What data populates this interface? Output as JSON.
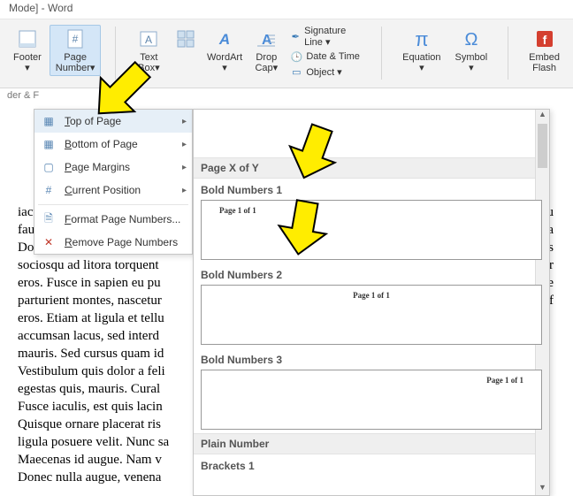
{
  "title": "Mode] - Word",
  "status": "der & F",
  "ribbon": {
    "footer": "Footer\n▾",
    "page_number": "Page\nNumber▾",
    "text_box": "Text\nBox▾",
    "quick_parts": "",
    "wordart": "WordArt\n▾",
    "drop_cap": "Drop\nCap▾",
    "signature": "Signature Line ▾",
    "datetime": "Date & Time",
    "object": "Object ▾",
    "equation": "Equation\n▾",
    "symbol": "Symbol\n▾",
    "embed_flash": "Embed\nFlash"
  },
  "menu": {
    "top": "Top of Page",
    "bottom": "Bottom of Page",
    "margins": "Page Margins",
    "current": "Current Position",
    "format": "Format Page Numbers...",
    "remove": "Remove Page Numbers"
  },
  "gallery": {
    "section": "Page X of Y",
    "items": [
      {
        "title": "Bold Numbers 1",
        "text": "Page 1 of 1",
        "align": "left"
      },
      {
        "title": "Bold Numbers 2",
        "text": "Page 1 of 1",
        "align": "center"
      },
      {
        "title": "Bold Numbers 3",
        "text": "Page 1 of 1",
        "align": "right"
      }
    ],
    "section2": "Plain Number",
    "item4_title": "Brackets 1"
  },
  "doc": [
    "iaculis nibh, vitae scelerisq",
    "faucibus at, quam.",
    "Donec elit est, consecteue",
    "sociosqu ad litora torquent",
    "eros. Fusce in sapien eu pu",
    "parturient montes, nascetur",
    "eros. Etiam at ligula et tellu",
    "accumsan lacus, sed interd",
    "mauris. Sed cursus quam id",
    "Vestibulum quis dolor a feli",
    "egestas quis, mauris. Cural",
    "Fusce iaculis, est quis lacin",
    "Quisque ornare placerat ris",
    "ligula posuere velit. Nunc sa",
    "Maecenas id augue. Nam v",
    "Donec nulla augue, venena"
  ],
  "doc_right": [
    "ctu",
    "da",
    "a s",
    "er",
    "gue",
    "eif",
    "",
    "",
    "",
    "",
    "",
    "",
    "",
    "",
    "",
    ""
  ]
}
